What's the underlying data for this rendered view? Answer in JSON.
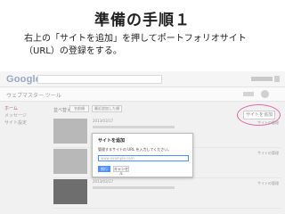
{
  "slide": {
    "title": "準備の手順１",
    "instruction": "右上の「サイトを追加」を押してポートフォリオサイト（URL）の登録をする。"
  },
  "screenshot": {
    "logo": "Google",
    "app_title": "ウェブマスター ツール",
    "nav": [
      "ホーム",
      "メッセージ",
      "サイト設定"
    ],
    "toolbar": {
      "label": "並べ替え",
      "buttons": [
        "名前順",
        "最近追加した順"
      ]
    },
    "add_site_button": "サイトを追加",
    "dialog": {
      "title": "サイトを追加",
      "desc": "管理するサイトの URL を入力してください。",
      "input_placeholder": "www.example.com",
      "add_label": "続行",
      "cancel_label": "キャンセル"
    },
    "rows": [
      {
        "date": "2013/03/17",
        "meta": "サイトの管理"
      },
      {
        "date": "2013/03/17",
        "meta": "サイトの管理"
      },
      {
        "date": "2013/03/17",
        "meta": "サイトの管理"
      }
    ]
  },
  "colors": {
    "highlight": "#e56aa8",
    "primary_button": "#4d90fe"
  }
}
